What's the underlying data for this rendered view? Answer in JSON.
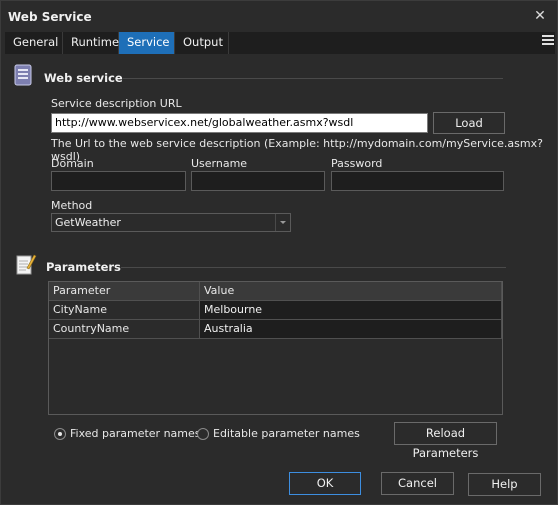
{
  "window": {
    "title": "Web Service",
    "close_glyph": "✕"
  },
  "tabs": [
    {
      "label": "General"
    },
    {
      "label": "Runtime"
    },
    {
      "label": "Service",
      "active": true
    },
    {
      "label": "Output"
    }
  ],
  "web_service": {
    "section_title": "Web service",
    "icon": "database-icon",
    "url_label": "Service description URL",
    "url_value": "http://www.webservicex.net/globalweather.asmx?wsdl",
    "load_label": "Load",
    "url_hint": "The Url to the web service description (Example: http://mydomain.com/myService.asmx?wsdl)",
    "domain_label": "Domain",
    "domain_value": "",
    "username_label": "Username",
    "username_value": "",
    "password_label": "Password",
    "password_value": "",
    "method_label": "Method",
    "method_value": "GetWeather"
  },
  "parameters": {
    "section_title": "Parameters",
    "icon": "notepad-pencil-icon",
    "columns": [
      "Parameter",
      "Value"
    ],
    "rows": [
      {
        "name": "CityName",
        "value": "Melbourne"
      },
      {
        "name": "CountryName",
        "value": "Australia"
      }
    ],
    "fixed_label": "Fixed parameter names",
    "editable_label": "Editable parameter names",
    "selected_mode": "fixed",
    "reload_label": "Reload Parameters"
  },
  "footer": {
    "ok_label": "OK",
    "cancel_label": "Cancel",
    "help_label": "Help"
  },
  "colors": {
    "background": "#2b2b2b",
    "tab_active": "#1e6fb8",
    "field_bg": "#1e1e1e",
    "default_button_border": "#3d8ee0"
  }
}
